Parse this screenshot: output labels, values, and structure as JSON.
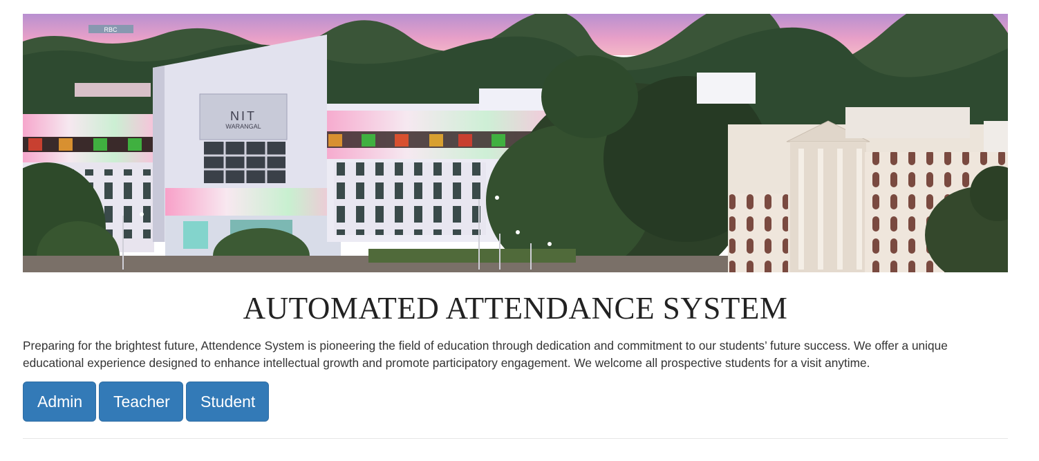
{
  "banner": {
    "sign_text": "NIT",
    "sign_subtext": "WARANGAL",
    "rooftop_text": "RBC"
  },
  "page": {
    "title": "AUTOMATED ATTENDANCE SYSTEM",
    "intro": "Preparing for the brightest future, Attendence System is pioneering the field of education through dedication and commitment to our students’ future success. We offer a unique educational experience designed to enhance intellectual growth and promote participatory engagement. We welcome all prospective students for a visit anytime."
  },
  "buttons": {
    "admin": "Admin",
    "teacher": "Teacher",
    "student": "Student"
  },
  "colors": {
    "button_bg": "#337ab7",
    "button_text": "#ffffff",
    "sky_top": "#b88ac8",
    "sky_horizon": "#f0a0c0"
  }
}
